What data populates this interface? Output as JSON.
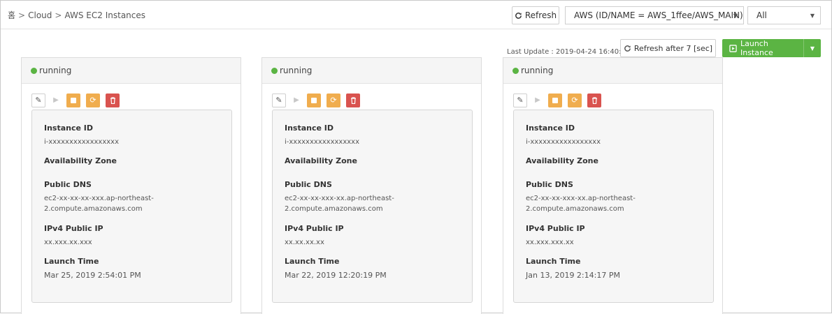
{
  "breadcrumb": {
    "home": "홈",
    "cloud": "Cloud",
    "current": "AWS EC2 Instances",
    "separator": ">"
  },
  "header": {
    "refresh_label": "Refresh",
    "account_select": "AWS (ID/NAME = AWS_1ffee/AWS_MAIN)",
    "filter_select": "All"
  },
  "actions": {
    "last_update": "Last Update : 2019-04-24 16:40:14",
    "refresh_after_label": "Refresh after 7 [sec]",
    "launch_label": "Launch Instance"
  },
  "labels": {
    "instance_id": "Instance ID",
    "availability_zone": "Availability Zone",
    "public_dns": "Public DNS",
    "ipv4_public_ip": "IPv4 Public IP",
    "launch_time": "Launch Time"
  },
  "instances": [
    {
      "status": "running",
      "instance_id": "i-xxxxxxxxxxxxxxxxx",
      "availability_zone": "",
      "public_dns_line1": "ec2-xx-xx-xx-xxx.ap-northeast-",
      "public_dns_line2": "2.compute.amazonaws.com",
      "ipv4": "xx.xxx.xx.xxx",
      "launch_time": "Mar 25, 2019 2:54:01 PM"
    },
    {
      "status": "running",
      "instance_id": "i-xxxxxxxxxxxxxxxxx",
      "availability_zone": "",
      "public_dns_line1": "ec2-xx-xx-xxx-xx.ap-northeast-",
      "public_dns_line2": "2.compute.amazonaws.com",
      "ipv4": "xx.xx.xx.xx",
      "launch_time": "Mar 22, 2019 12:20:19 PM"
    },
    {
      "status": "running",
      "instance_id": "i-xxxxxxxxxxxxxxxxx",
      "availability_zone": "",
      "public_dns_line1": "ec2-xx-xx-xxx-xx.ap-northeast-",
      "public_dns_line2": "2.compute.amazonaws.com",
      "ipv4": "xx.xxx.xxx.xx",
      "launch_time": "Jan 13, 2019 2:14:17 PM"
    }
  ],
  "colors": {
    "running": "#5bb443",
    "warning": "#f0ad4e",
    "danger": "#d9534f",
    "launch": "#5bb443"
  },
  "icons": [
    "refresh-icon",
    "caret-down-icon",
    "launch-icon",
    "edit-icon",
    "play-icon",
    "stop-icon",
    "reboot-icon",
    "trash-icon"
  ]
}
